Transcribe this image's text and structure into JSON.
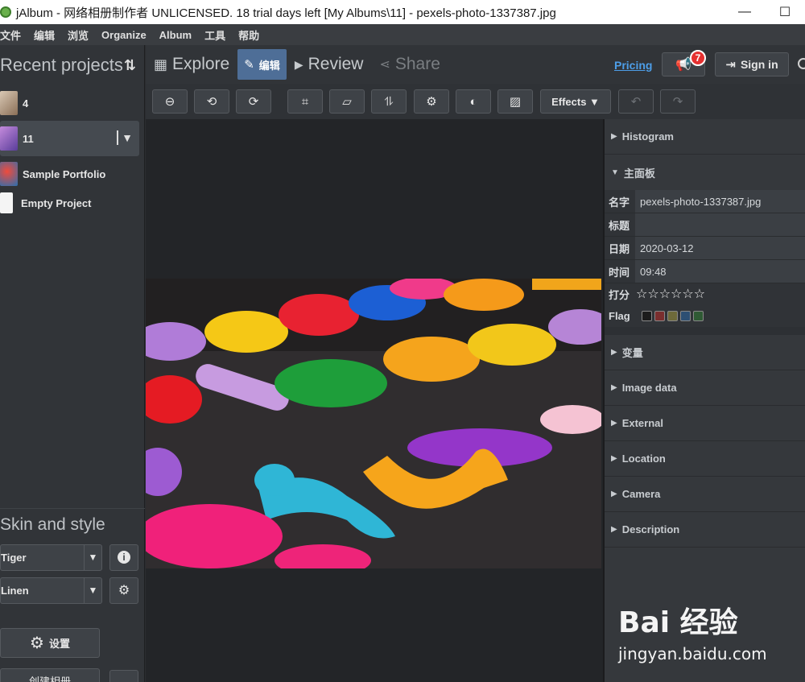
{
  "window": {
    "title": "jAlbum - 网络相册制作者 UNLICENSED. 18 trial days left [My Albums\\11] - pexels-photo-1337387.jpg",
    "minimize": "—",
    "maximize": "☐"
  },
  "menu": [
    "文件",
    "编辑",
    "浏览",
    "Organize",
    "Album",
    "工具",
    "帮助"
  ],
  "left": {
    "header": "Recent projects",
    "sort_icon": "⇅",
    "projects": [
      {
        "name": "4"
      },
      {
        "name": "11"
      },
      {
        "name": "Sample Portfolio"
      },
      {
        "name": "Empty Project"
      }
    ],
    "skin_title": "Skin and style",
    "skin": "Tiger",
    "style": "Linen",
    "settings_label": "设置",
    "create_label": "创建相册"
  },
  "nav": {
    "explore": "Explore",
    "edit": "编辑",
    "review": "Review",
    "share": "Share",
    "pricing": "Pricing",
    "notifications": "7",
    "signin": "Sign in"
  },
  "toolbar": {
    "effects": "Effects ▼"
  },
  "right": {
    "histogram": "Histogram",
    "main_panel": "主面板",
    "props": [
      {
        "key": "名字",
        "value": "pexels-photo-1337387.jpg"
      },
      {
        "key": "标题",
        "value": ""
      },
      {
        "key": "日期",
        "value": "2020-03-12"
      },
      {
        "key": "时间",
        "value": "09:48"
      }
    ],
    "rating_label": "打分",
    "stars": "☆☆☆☆☆☆",
    "flag_label": "Flag",
    "flag_colors": [
      "#1c1c1c",
      "#7a2e2e",
      "#6e6a3a",
      "#2d4f73",
      "#2f5a34"
    ],
    "sections": [
      "变量",
      "Image data",
      "External",
      "Location",
      "Camera",
      "Description"
    ]
  },
  "watermark": {
    "logo": "Bai 经验",
    "url": "jingyan.baidu.com"
  }
}
